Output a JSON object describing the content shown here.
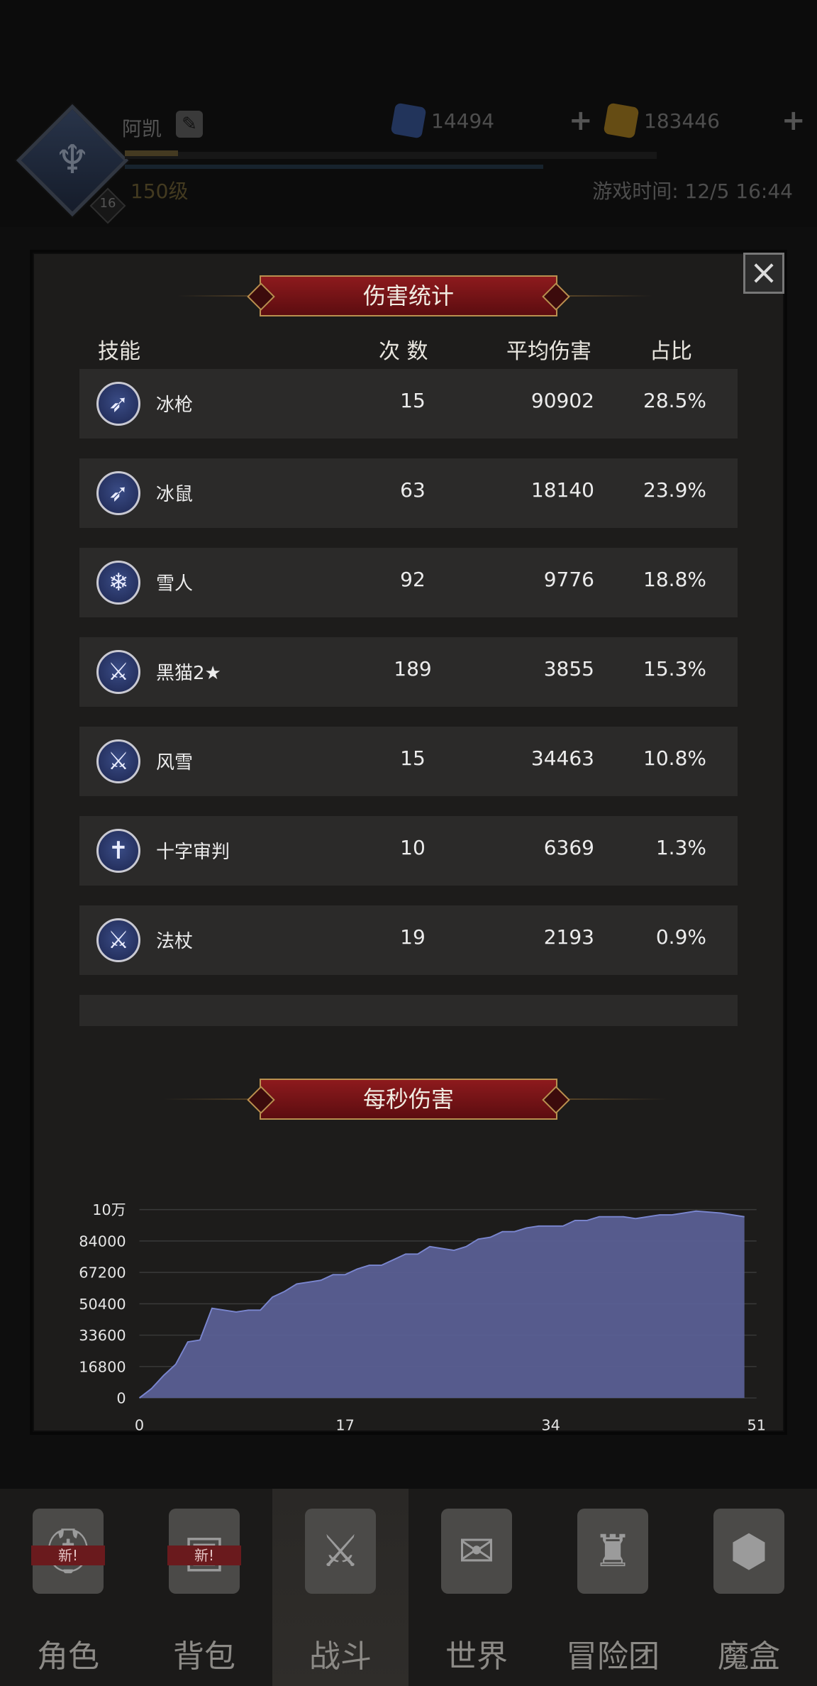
{
  "hud": {
    "player_name": "阿凯",
    "level_label": "150级",
    "avatar_badge": "16",
    "gem_value": "14494",
    "gold_value": "183446",
    "game_time": "游戏时间: 12/5 16:44"
  },
  "modal": {
    "title": "伤害统计",
    "close_label": "×",
    "columns": {
      "skill": "技能",
      "count": "次 数",
      "avg": "平均伤害",
      "ratio": "占比"
    },
    "rows": [
      {
        "icon": "arrows-icon",
        "glyph": "➶",
        "name": "冰枪",
        "count": "15",
        "avg": "90902",
        "ratio": "28.5%"
      },
      {
        "icon": "arrows-icon",
        "glyph": "➶",
        "name": "冰鼠",
        "count": "63",
        "avg": "18140",
        "ratio": "23.9%"
      },
      {
        "icon": "snowflake-icon",
        "glyph": "❄",
        "name": "雪人",
        "count": "92",
        "avg": "9776",
        "ratio": "18.8%"
      },
      {
        "icon": "sword-icon",
        "glyph": "⚔",
        "name": "黑猫2★",
        "count": "189",
        "avg": "3855",
        "ratio": "15.3%"
      },
      {
        "icon": "sword-icon",
        "glyph": "⚔",
        "name": "风雪",
        "count": "15",
        "avg": "34463",
        "ratio": "10.8%"
      },
      {
        "icon": "banner-cross-icon",
        "glyph": "✝",
        "name": "十字审判",
        "count": "10",
        "avg": "6369",
        "ratio": "1.3%"
      },
      {
        "icon": "sword-icon",
        "glyph": "⚔",
        "name": "法杖",
        "count": "19",
        "avg": "2193",
        "ratio": "0.9%"
      }
    ],
    "dps_title": "每秒伤害"
  },
  "chart_data": {
    "type": "area",
    "title": "每秒伤害",
    "x": [
      0,
      1,
      2,
      3,
      4,
      5,
      6,
      7,
      8,
      9,
      10,
      11,
      12,
      13,
      14,
      15,
      16,
      17,
      18,
      19,
      20,
      21,
      22,
      23,
      24,
      25,
      26,
      27,
      28,
      29,
      30,
      31,
      32,
      33,
      34,
      35,
      36,
      37,
      38,
      39,
      40,
      41,
      42,
      43,
      44,
      45,
      46,
      47,
      48,
      49,
      50
    ],
    "values": [
      0,
      5000,
      12000,
      18000,
      30000,
      31000,
      48000,
      47000,
      46000,
      47000,
      47000,
      54000,
      57000,
      61000,
      62000,
      63000,
      66000,
      66000,
      69000,
      71000,
      71000,
      74000,
      77000,
      77000,
      81000,
      80000,
      79000,
      81000,
      85000,
      86000,
      89000,
      89000,
      91000,
      92000,
      92000,
      92000,
      95000,
      95000,
      97000,
      97000,
      97000,
      96000,
      97000,
      98000,
      98000,
      99000,
      100000,
      99500,
      99000,
      98000,
      97000
    ],
    "xlim": [
      0,
      51
    ],
    "ylim": [
      0,
      100800
    ],
    "xticks": [
      "0",
      "17",
      "34",
      "51"
    ],
    "yticks": [
      "0",
      "16800",
      "33600",
      "50400",
      "67200",
      "84000",
      "10万"
    ],
    "fill_color": "#5a5f94",
    "stroke_color": "#7a86cf",
    "grid": true
  },
  "nav": {
    "items": [
      {
        "label": "角色",
        "icon": "knight-helmet-icon",
        "glyph": "⛑",
        "badge": "新!"
      },
      {
        "label": "背包",
        "icon": "backpack-icon",
        "glyph": "▣",
        "badge": "新!"
      },
      {
        "label": "战斗",
        "icon": "shield-sword-icon",
        "glyph": "⚔",
        "badge": ""
      },
      {
        "label": "世界",
        "icon": "map-scroll-icon",
        "glyph": "✉",
        "badge": ""
      },
      {
        "label": "冒险团",
        "icon": "castle-icon",
        "glyph": "♜",
        "badge": ""
      },
      {
        "label": "魔盒",
        "icon": "magic-cube-icon",
        "glyph": "⬢",
        "badge": ""
      }
    ]
  },
  "colors": {
    "banner": "#8d1a1d",
    "banner_border": "#b9904f",
    "row_bg": "#2b2a29",
    "gem": "#3e5fa7",
    "gold": "#b88a25"
  }
}
